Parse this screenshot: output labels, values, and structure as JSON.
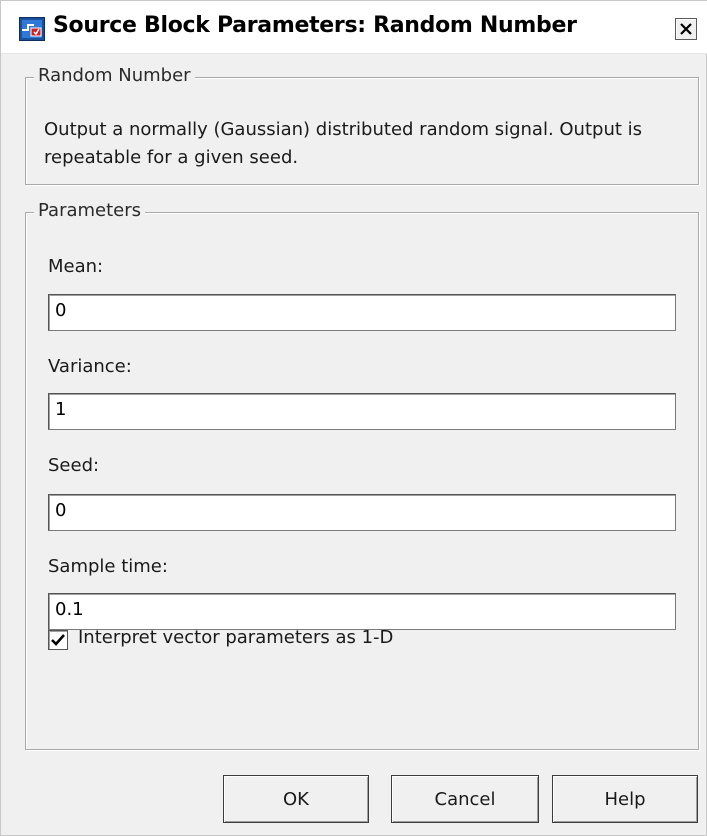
{
  "window": {
    "title": "Source Block Parameters: Random Number",
    "close_glyph": "✕"
  },
  "description_group": {
    "legend": "Random Number",
    "text": "Output a normally (Gaussian) distributed random signal.  Output is repeatable for a given seed."
  },
  "parameters_group": {
    "legend": "Parameters",
    "fields": [
      {
        "label": "Mean:",
        "value": "0"
      },
      {
        "label": "Variance:",
        "value": "1"
      },
      {
        "label": "Seed:",
        "value": "0"
      },
      {
        "label": "Sample time:",
        "value": "0.1"
      }
    ],
    "interpret_vector": {
      "label": "Interpret vector parameters as 1-D",
      "checked": true
    }
  },
  "buttons": {
    "ok": "OK",
    "cancel": "Cancel",
    "help": "Help"
  },
  "icons": {
    "app": "simulink-block-icon",
    "close": "close-icon",
    "check": "checkmark-icon"
  }
}
